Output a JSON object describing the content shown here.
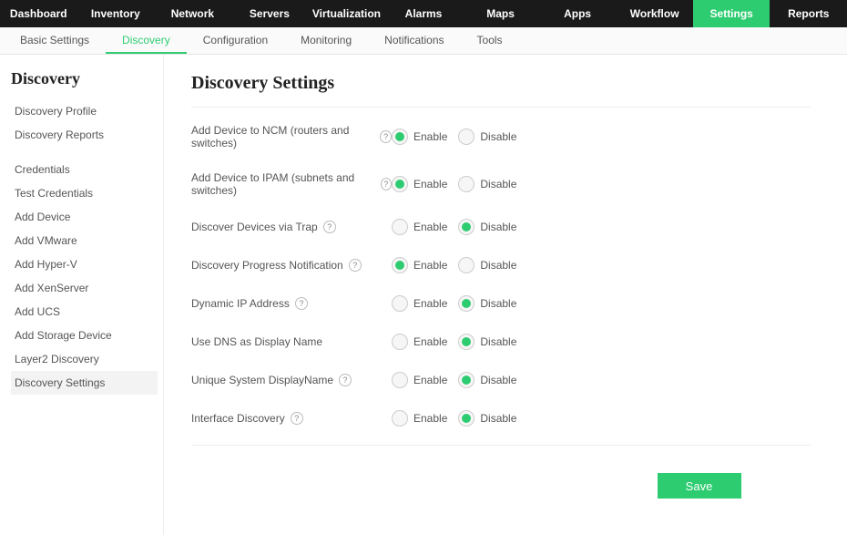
{
  "topnav": {
    "items": [
      "Dashboard",
      "Inventory",
      "Network",
      "Servers",
      "Virtualization",
      "Alarms",
      "Maps",
      "Apps",
      "Workflow",
      "Settings",
      "Reports"
    ],
    "active": "Settings"
  },
  "subnav": {
    "items": [
      "Basic Settings",
      "Discovery",
      "Configuration",
      "Monitoring",
      "Notifications",
      "Tools"
    ],
    "active": "Discovery"
  },
  "sidebar": {
    "title": "Discovery",
    "groups": [
      [
        "Discovery Profile",
        "Discovery Reports"
      ],
      [
        "Credentials",
        "Test Credentials",
        "Add Device",
        "Add VMware",
        "Add Hyper-V",
        "Add XenServer",
        "Add UCS",
        "Add Storage Device",
        "Layer2 Discovery",
        "Discovery Settings"
      ]
    ],
    "selected": "Discovery Settings"
  },
  "page": {
    "title": "Discovery Settings",
    "enable": "Enable",
    "disable": "Disable",
    "save": "Save",
    "rows": [
      {
        "label": "Add Device to NCM (routers and switches)",
        "help": true,
        "value": "enable"
      },
      {
        "label": "Add Device to IPAM (subnets and switches)",
        "help": true,
        "value": "enable"
      },
      {
        "label": "Discover Devices via Trap",
        "help": true,
        "value": "disable"
      },
      {
        "label": "Discovery Progress Notification",
        "help": true,
        "value": "enable"
      },
      {
        "label": "Dynamic IP Address",
        "help": true,
        "value": "disable"
      },
      {
        "label": "Use DNS as Display Name",
        "help": false,
        "value": "disable"
      },
      {
        "label": "Unique System DisplayName",
        "help": true,
        "value": "disable"
      },
      {
        "label": "Interface Discovery",
        "help": true,
        "value": "disable"
      }
    ]
  }
}
